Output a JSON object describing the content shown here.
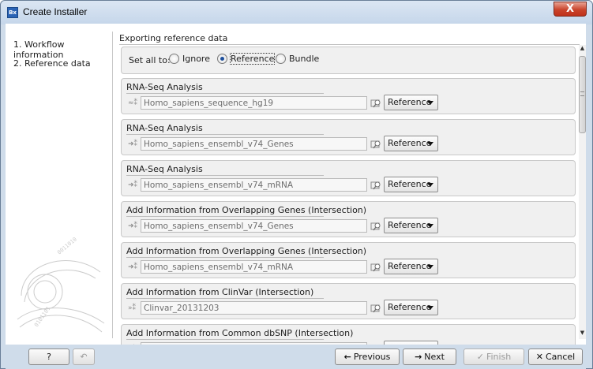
{
  "window": {
    "title": "Create Installer",
    "app_icon_text": "Bx",
    "close_label": "X"
  },
  "steps": [
    {
      "label": "1.  Workflow information"
    },
    {
      "label": "2.  Reference data"
    }
  ],
  "panel": {
    "title": "Exporting reference data",
    "set_all": {
      "label": "Set all to:",
      "options": [
        {
          "label": "Ignore",
          "selected": false
        },
        {
          "label": "Reference",
          "selected": true
        },
        {
          "label": "Bundle",
          "selected": false
        }
      ]
    },
    "sections": [
      {
        "title": "RNA-Seq Analysis",
        "icon": "sequence-icon",
        "icon_glyph": "≈⁑",
        "value": "Homo_sapiens_sequence_hg19",
        "dropdown": "Reference"
      },
      {
        "title": "RNA-Seq Analysis",
        "icon": "track-icon",
        "icon_glyph": "➜⁑",
        "value": "Homo_sapiens_ensembl_v74_Genes",
        "dropdown": "Reference"
      },
      {
        "title": "RNA-Seq Analysis",
        "icon": "track-icon",
        "icon_glyph": "➜⁑",
        "value": "Homo_sapiens_ensembl_v74_mRNA",
        "dropdown": "Reference"
      },
      {
        "title": "Add Information from Overlapping Genes (Intersection)",
        "icon": "track-icon",
        "icon_glyph": "➜⁑",
        "value": "Homo_sapiens_ensembl_v74_Genes",
        "dropdown": "Reference"
      },
      {
        "title": "Add Information from Overlapping Genes (Intersection)",
        "icon": "track-icon",
        "icon_glyph": "➜⁑",
        "value": "Homo_sapiens_ensembl_v74_mRNA",
        "dropdown": "Reference"
      },
      {
        "title": "Add Information from ClinVar (Intersection)",
        "icon": "variant-track-icon",
        "icon_glyph": "»⁑",
        "value": "Clinvar_20131203",
        "dropdown": "Reference"
      },
      {
        "title": "Add Information from Common dbSNP (Intersection)",
        "icon": "variant-track-icon",
        "icon_glyph": "»⁑",
        "value": "",
        "dropdown": ""
      }
    ]
  },
  "footer": {
    "help": "?",
    "previous": "Previous",
    "next": "Next",
    "finish": "Finish",
    "cancel": "Cancel"
  }
}
